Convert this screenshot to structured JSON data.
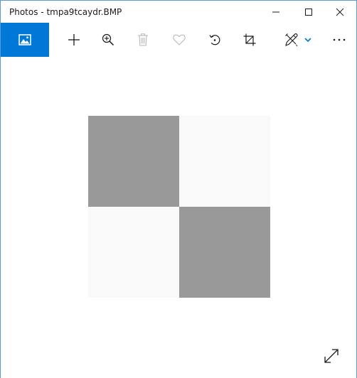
{
  "window": {
    "title": "Photos - tmpa9tcaydr.BMP",
    "controls": [
      "minimize",
      "maximize",
      "close"
    ]
  },
  "toolbar": {
    "accent_color": "#0078d7",
    "buttons": [
      {
        "id": "home",
        "icon": "photo-icon"
      },
      {
        "id": "add",
        "icon": "plus-icon"
      },
      {
        "id": "zoom",
        "icon": "zoom-in-icon"
      },
      {
        "id": "delete",
        "icon": "trash-icon",
        "enabled": false
      },
      {
        "id": "favorite",
        "icon": "heart-icon",
        "enabled": false
      },
      {
        "id": "rotate",
        "icon": "rotate-icon"
      },
      {
        "id": "crop",
        "icon": "crop-icon"
      },
      {
        "id": "edit",
        "icon": "pencil-brush-icon",
        "has_dropdown": true
      },
      {
        "id": "more",
        "icon": "ellipsis-icon"
      }
    ]
  },
  "image": {
    "pattern": "checkerboard-2x2",
    "colors": {
      "dark": "#999999",
      "light": "#f9f9f9"
    },
    "cells": [
      "dark",
      "light",
      "light",
      "dark"
    ]
  },
  "viewer": {
    "fullscreen_icon": "expand-icon"
  }
}
